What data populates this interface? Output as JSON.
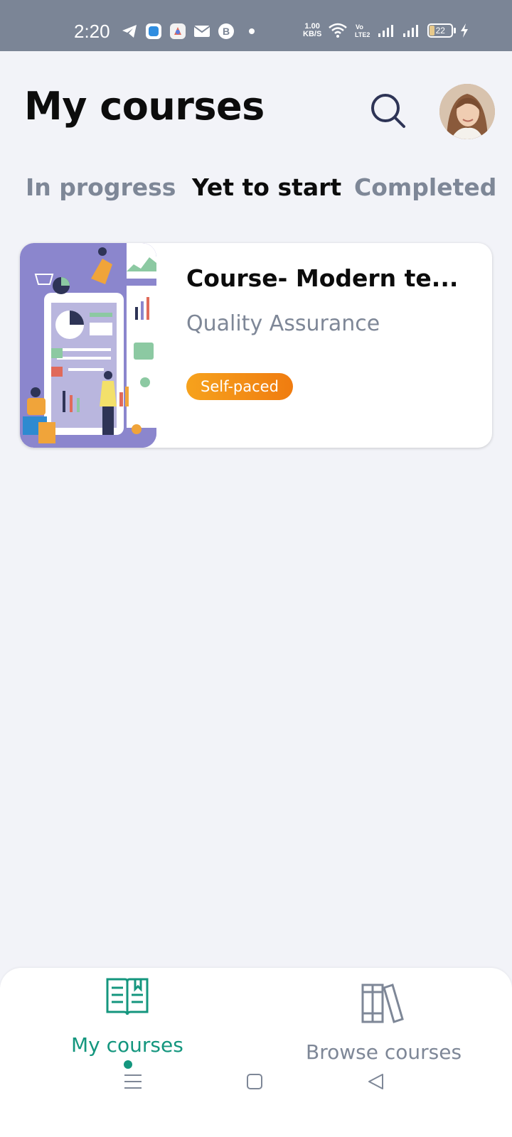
{
  "status_bar": {
    "time": "2:20",
    "net_speed_value": "1.00",
    "net_speed_unit": "KB/S",
    "volte": "Vo LTE2",
    "battery": "22",
    "icons": [
      "telegram-icon",
      "app-icon",
      "app-icon-2",
      "mail-icon",
      "b-icon",
      "dot-icon",
      "wifi-icon",
      "signal-icon",
      "signal-icon-2",
      "battery-icon",
      "charging-icon"
    ]
  },
  "header": {
    "title": "My courses",
    "search_icon": "search-icon",
    "avatar": "user-avatar"
  },
  "tabs": [
    {
      "label": "In progress",
      "active": false
    },
    {
      "label": "Yet to start",
      "active": true
    },
    {
      "label": "Completed",
      "active": false
    }
  ],
  "courses": [
    {
      "title": "Course- Modern te...",
      "subtitle": "Quality Assurance",
      "badge": "Self-paced"
    }
  ],
  "bottom_nav": {
    "items": [
      {
        "label": "My courses",
        "icon": "open-book-icon",
        "active": true
      },
      {
        "label": "Browse courses",
        "icon": "books-icon",
        "active": false
      }
    ]
  },
  "system_nav": [
    "menu-icon",
    "home-icon",
    "back-icon"
  ],
  "colors": {
    "accent": "#14967e",
    "badge": "#f28a14",
    "muted_text": "#7e8797",
    "background": "#f2f3f8",
    "status_bar": "#7b8596"
  }
}
